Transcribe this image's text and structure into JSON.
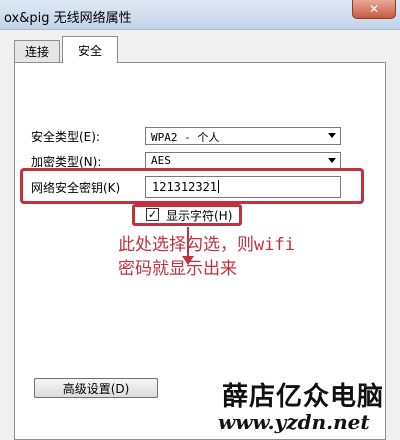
{
  "window": {
    "title": "ox&pig 无线网络属性",
    "close_label": "✕"
  },
  "tabs": [
    {
      "label": "连接",
      "active": false
    },
    {
      "label": "安全",
      "active": true
    }
  ],
  "security": {
    "type_label": "安全类型(E):",
    "type_value": "WPA2 - 个人",
    "encryption_label": "加密类型(N):",
    "encryption_value": "AES",
    "key_label": "网络安全密钥(K)",
    "key_value": "121312321",
    "show_chars_label": "显示字符(H)",
    "show_chars_checked": "✓"
  },
  "annotation": {
    "line1": "此处选择勾选，则wifi",
    "line2": "密码就显示出来",
    "color": "#c2313c"
  },
  "buttons": {
    "advanced_label": "高级设置(D)"
  },
  "watermark": {
    "line1": "薛店亿众电脑",
    "line2": "www.yzdn.net"
  }
}
